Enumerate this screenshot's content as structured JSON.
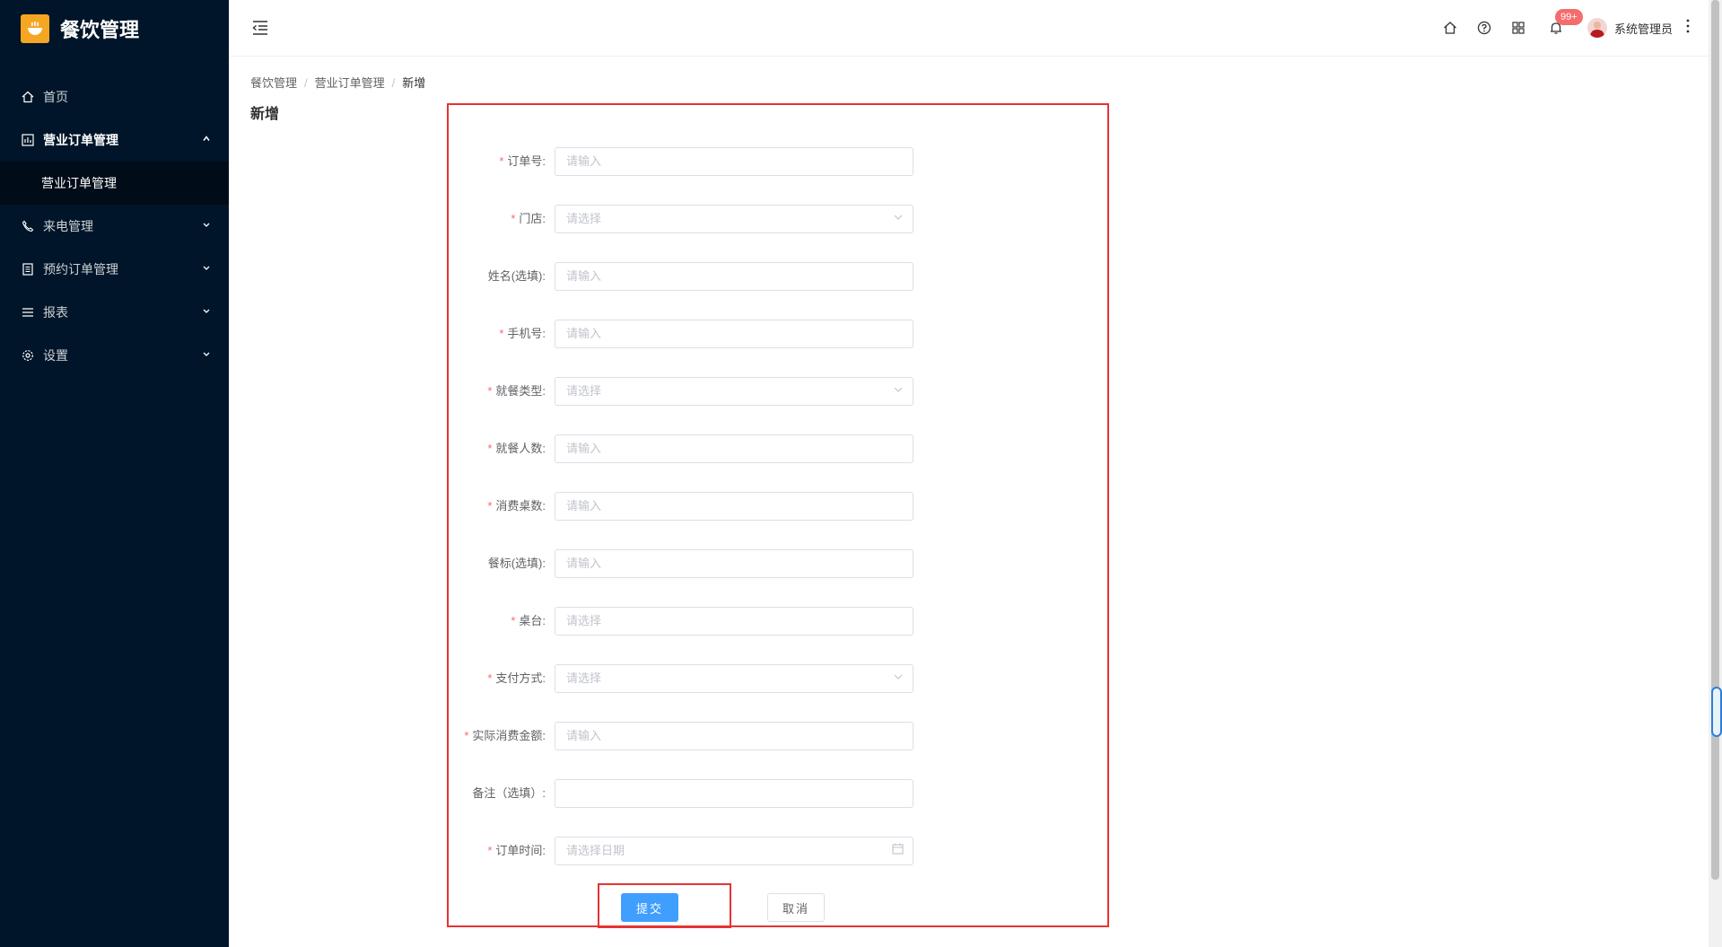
{
  "app": {
    "title": "餐饮管理"
  },
  "sidebar": {
    "items": [
      {
        "label": "首页",
        "icon": "home-icon"
      },
      {
        "label": "营业订单管理",
        "icon": "chart-box-icon",
        "open": true,
        "children": [
          {
            "label": "营业订单管理"
          }
        ]
      },
      {
        "label": "来电管理",
        "icon": "phone-icon"
      },
      {
        "label": "预约订单管理",
        "icon": "document-icon"
      },
      {
        "label": "报表",
        "icon": "list-icon"
      },
      {
        "label": "设置",
        "icon": "gear-icon"
      }
    ]
  },
  "header": {
    "badge": "99+",
    "username": "系统管理员"
  },
  "breadcrumb": [
    "餐饮管理",
    "营业订单管理",
    "新增"
  ],
  "page_title": "新增",
  "form": {
    "fields": [
      {
        "label": "订单号:",
        "required": true,
        "placeholder": "请输入",
        "type": "input"
      },
      {
        "label": "门店:",
        "required": true,
        "placeholder": "请选择",
        "type": "select"
      },
      {
        "label": "姓名(选填):",
        "required": false,
        "placeholder": "请输入",
        "type": "input"
      },
      {
        "label": "手机号:",
        "required": true,
        "placeholder": "请输入",
        "type": "input"
      },
      {
        "label": "就餐类型:",
        "required": true,
        "placeholder": "请选择",
        "type": "select"
      },
      {
        "label": "就餐人数:",
        "required": true,
        "placeholder": "请输入",
        "type": "input"
      },
      {
        "label": "消费桌数:",
        "required": true,
        "placeholder": "请输入",
        "type": "input"
      },
      {
        "label": "餐标(选填):",
        "required": false,
        "placeholder": "请输入",
        "type": "input"
      },
      {
        "label": "桌台:",
        "required": true,
        "placeholder": "请选择",
        "type": "input"
      },
      {
        "label": "支付方式:",
        "required": true,
        "placeholder": "请选择",
        "type": "select"
      },
      {
        "label": "实际消费金额:",
        "required": true,
        "placeholder": "请输入",
        "type": "input"
      },
      {
        "label": "备注（选填）:",
        "required": false,
        "placeholder": "",
        "type": "input"
      },
      {
        "label": "订单时间:",
        "required": true,
        "placeholder": "请选择日期",
        "type": "date"
      }
    ],
    "required_mark": "*",
    "submit_label": "提交",
    "cancel_label": "取消"
  },
  "colors": {
    "sidebar_bg": "#001529",
    "primary": "#409eff",
    "highlight": "#e53333",
    "required": "#f56c6c"
  }
}
